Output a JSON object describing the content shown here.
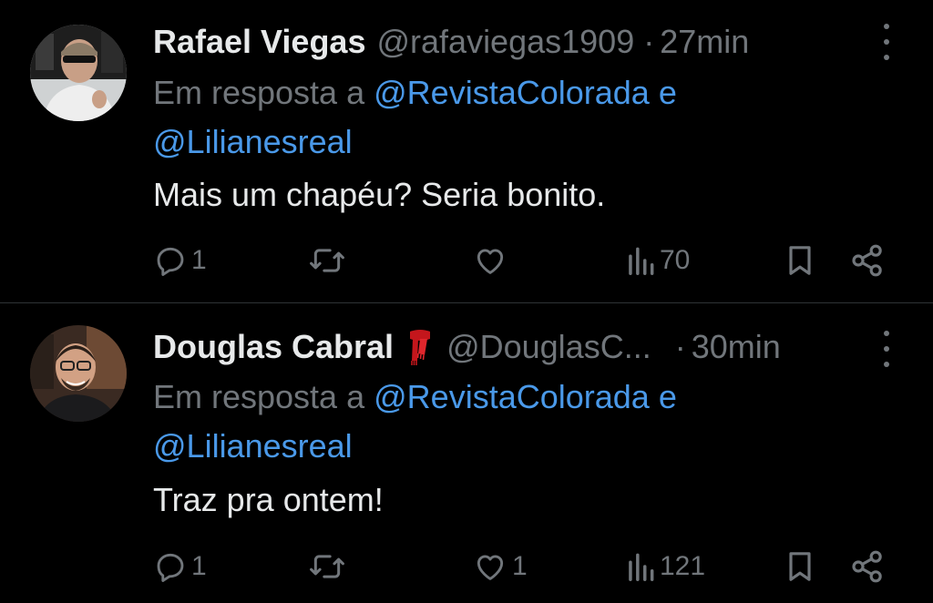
{
  "tweets": [
    {
      "name": "Rafael Viegas",
      "handle": "@rafaviegas1909",
      "separator": "·",
      "time": "27min",
      "emoji": "",
      "reply_prefix": "Em resposta a",
      "mention1": "@RevistaColorada",
      "connector": "e",
      "mention2": "@Lilianesreal",
      "text": "Mais um chapéu? Seria bonito.",
      "replies": "1",
      "retweets": "",
      "likes": "",
      "views": "70"
    },
    {
      "name": "Douglas Cabral",
      "handle": "@DouglasC...",
      "separator": "·",
      "time": "30min",
      "emoji": "scarf",
      "reply_prefix": "Em resposta a",
      "mention1": "@RevistaColorada",
      "connector": "e",
      "mention2": "@Lilianesreal",
      "text": "Traz pra ontem!",
      "replies": "1",
      "retweets": "",
      "likes": "1",
      "views": "121"
    }
  ],
  "icons": {
    "reply": "reply-icon",
    "retweet": "retweet-icon",
    "like": "heart-icon",
    "views": "views-icon",
    "bookmark": "bookmark-icon",
    "share": "share-icon",
    "more": "more-vertical-icon"
  },
  "colors": {
    "background": "#000000",
    "text": "#e7e9ea",
    "muted": "#71767b",
    "link": "#4a99e9",
    "divider": "#2f3336"
  }
}
